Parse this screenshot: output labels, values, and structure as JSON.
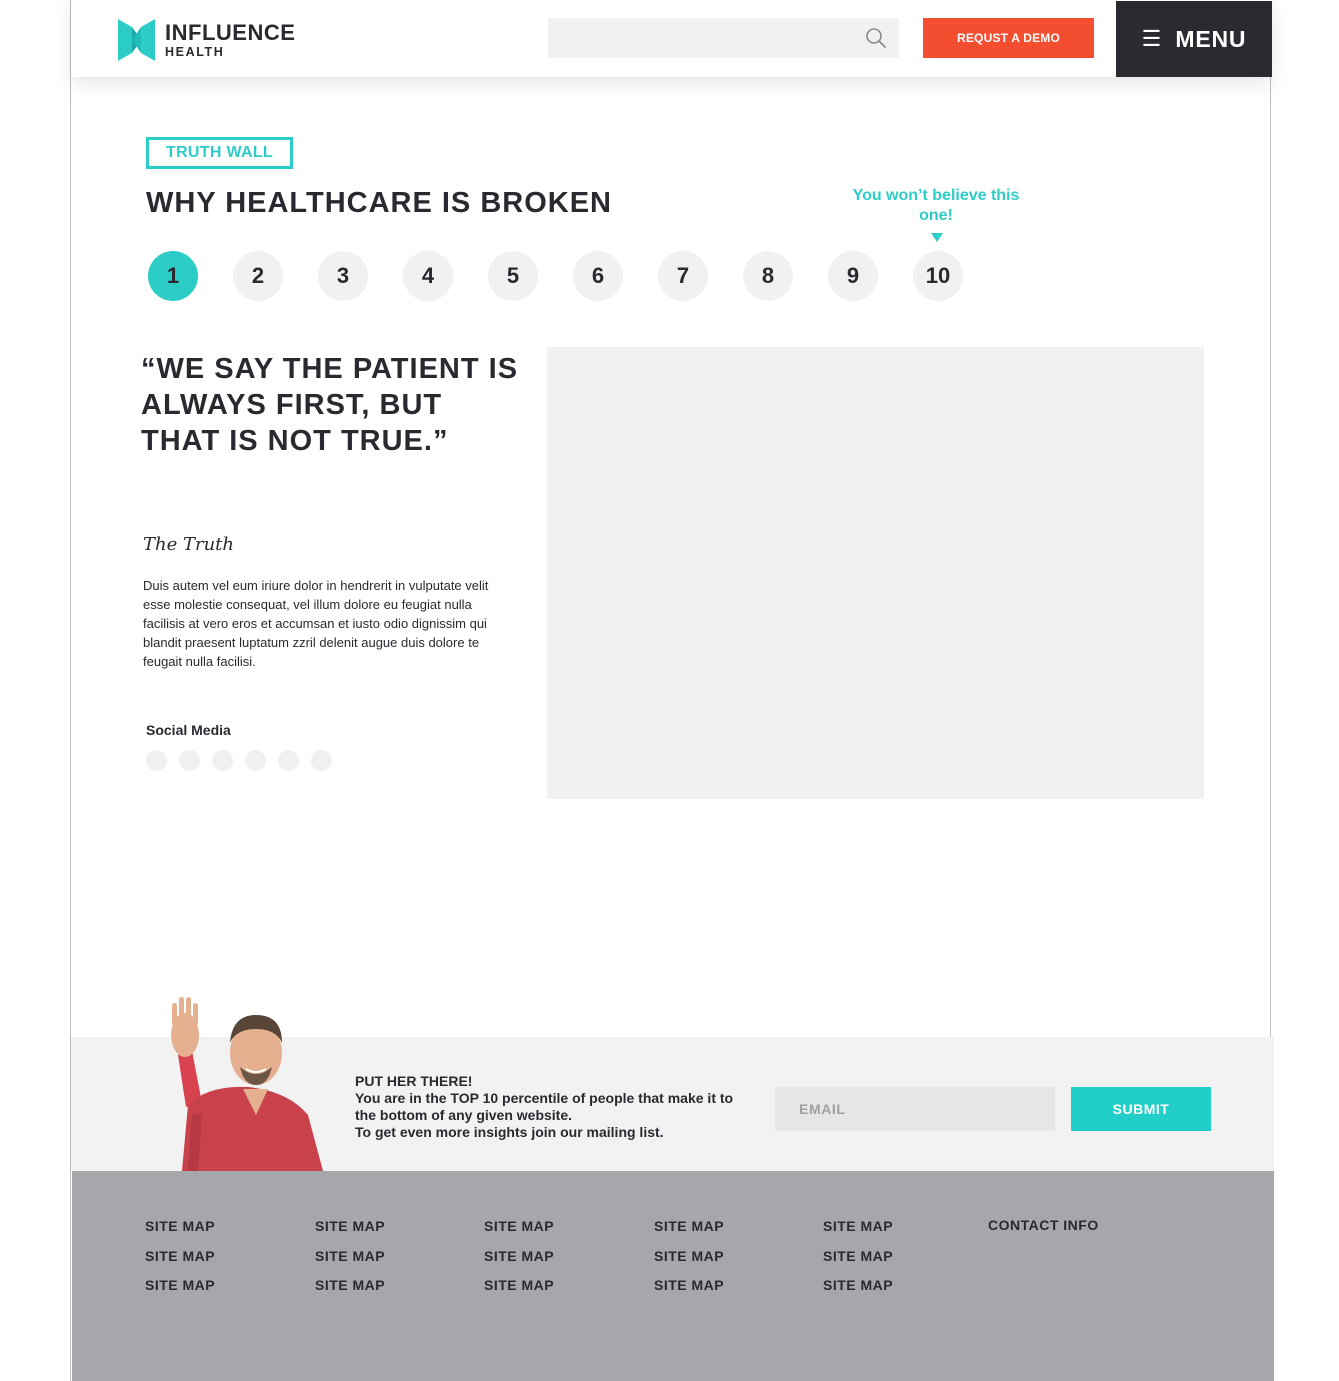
{
  "header": {
    "logo": {
      "line1": "INFLUENCE",
      "line2": "HEALTH",
      "color": "#2dcdc7",
      "icon": "influence-health-logo-icon"
    },
    "search": {
      "placeholder": "",
      "icon": "search-icon"
    },
    "demo_button": "REQUST A DEMO",
    "menu": {
      "icon": "hamburger-icon",
      "label": "MENU"
    }
  },
  "truth_wall": {
    "tag": "TRUTH WALL",
    "title": "WHY HEALTHCARE IS BROKEN",
    "callout": "You won’t believe this one!",
    "steps": [
      "1",
      "2",
      "3",
      "4",
      "5",
      "6",
      "7",
      "8",
      "9",
      "10"
    ],
    "active_step": "1",
    "quote": "“WE SAY THE PATIENT IS ALWAYS FIRST, BUT THAT IS NOT TRUE.”",
    "truth_label": "The Truth",
    "body": "Duis autem vel eum iriure dolor in hendrerit in vulputate velit esse molestie consequat, vel illum dolore eu feugiat nulla facilisis at vero eros et accumsan et iusto odio dignissim qui blandit praesent luptatum zzril delenit augue duis dolore te feugait nulla facilisi.",
    "social_label": "Social Media",
    "social_icons": [
      "social-icon",
      "social-icon",
      "social-icon",
      "social-icon",
      "social-icon",
      "social-icon"
    ]
  },
  "newsletter": {
    "heading": "PUT HER THERE!",
    "line1": "You are in the TOP 10 percentile of people that make it to the bottom of any given website.",
    "line2": "To get even more insights join our mailing list.",
    "email_placeholder": "EMAIL",
    "submit": "SUBMIT"
  },
  "footer": {
    "columns": [
      [
        "SITE MAP",
        "SITE MAP",
        "SITE MAP"
      ],
      [
        "SITE MAP",
        "SITE MAP",
        "SITE MAP"
      ],
      [
        "SITE MAP",
        "SITE MAP",
        "SITE MAP"
      ],
      [
        "SITE MAP",
        "SITE MAP",
        "SITE MAP"
      ],
      [
        "SITE MAP",
        "SITE MAP",
        "SITE MAP"
      ]
    ],
    "contact": "CONTACT INFO"
  },
  "colors": {
    "accent": "#2dcdc7",
    "cta": "#f34e2f",
    "dark": "#2c2a30",
    "footer": "#a6a7aa"
  }
}
